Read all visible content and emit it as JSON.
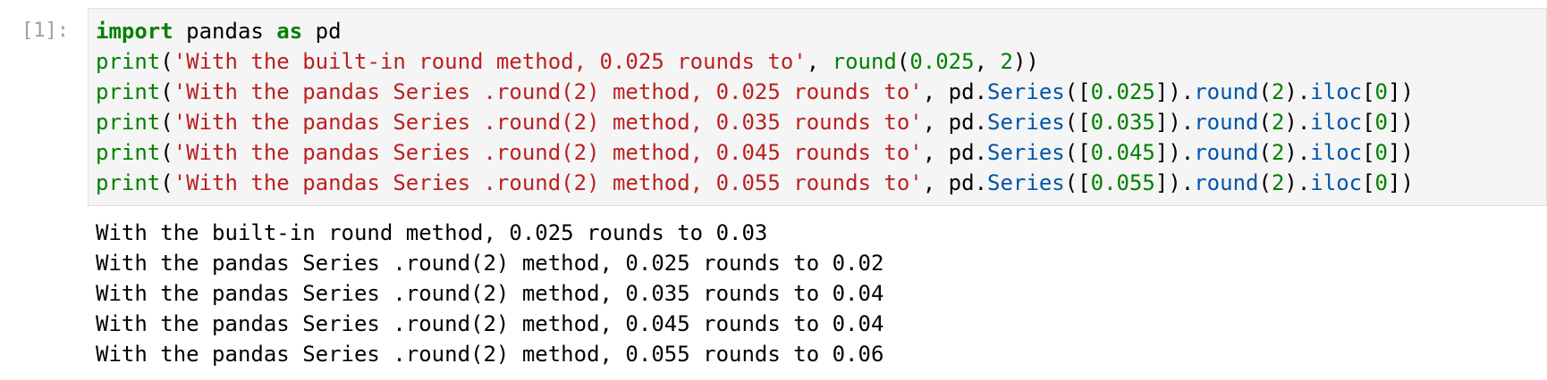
{
  "cell": {
    "prompt": "[1]:",
    "code_lines": [
      [
        {
          "t": "import",
          "c": "kw"
        },
        {
          "t": " pandas ",
          "c": ""
        },
        {
          "t": "as",
          "c": "kw"
        },
        {
          "t": " pd",
          "c": ""
        }
      ],
      [
        {
          "t": "print",
          "c": "bi"
        },
        {
          "t": "(",
          "c": ""
        },
        {
          "t": "'With the built-in round method, 0.025 rounds to'",
          "c": "str"
        },
        {
          "t": ", ",
          "c": ""
        },
        {
          "t": "round",
          "c": "bi"
        },
        {
          "t": "(",
          "c": ""
        },
        {
          "t": "0.025",
          "c": "num"
        },
        {
          "t": ", ",
          "c": ""
        },
        {
          "t": "2",
          "c": "num"
        },
        {
          "t": "))",
          "c": ""
        }
      ],
      [
        {
          "t": "print",
          "c": "bi"
        },
        {
          "t": "(",
          "c": ""
        },
        {
          "t": "'With the pandas Series .round(2) method, 0.025 rounds to'",
          "c": "str"
        },
        {
          "t": ", pd.",
          "c": ""
        },
        {
          "t": "Series",
          "c": "attr"
        },
        {
          "t": "([",
          "c": ""
        },
        {
          "t": "0.025",
          "c": "num"
        },
        {
          "t": "]).",
          "c": ""
        },
        {
          "t": "round",
          "c": "attr"
        },
        {
          "t": "(",
          "c": ""
        },
        {
          "t": "2",
          "c": "num"
        },
        {
          "t": ").",
          "c": ""
        },
        {
          "t": "iloc",
          "c": "attr"
        },
        {
          "t": "[",
          "c": ""
        },
        {
          "t": "0",
          "c": "num"
        },
        {
          "t": "])",
          "c": ""
        }
      ],
      [
        {
          "t": "print",
          "c": "bi"
        },
        {
          "t": "(",
          "c": ""
        },
        {
          "t": "'With the pandas Series .round(2) method, 0.035 rounds to'",
          "c": "str"
        },
        {
          "t": ", pd.",
          "c": ""
        },
        {
          "t": "Series",
          "c": "attr"
        },
        {
          "t": "([",
          "c": ""
        },
        {
          "t": "0.035",
          "c": "num"
        },
        {
          "t": "]).",
          "c": ""
        },
        {
          "t": "round",
          "c": "attr"
        },
        {
          "t": "(",
          "c": ""
        },
        {
          "t": "2",
          "c": "num"
        },
        {
          "t": ").",
          "c": ""
        },
        {
          "t": "iloc",
          "c": "attr"
        },
        {
          "t": "[",
          "c": ""
        },
        {
          "t": "0",
          "c": "num"
        },
        {
          "t": "])",
          "c": ""
        }
      ],
      [
        {
          "t": "print",
          "c": "bi"
        },
        {
          "t": "(",
          "c": ""
        },
        {
          "t": "'With the pandas Series .round(2) method, 0.045 rounds to'",
          "c": "str"
        },
        {
          "t": ", pd.",
          "c": ""
        },
        {
          "t": "Series",
          "c": "attr"
        },
        {
          "t": "([",
          "c": ""
        },
        {
          "t": "0.045",
          "c": "num"
        },
        {
          "t": "]).",
          "c": ""
        },
        {
          "t": "round",
          "c": "attr"
        },
        {
          "t": "(",
          "c": ""
        },
        {
          "t": "2",
          "c": "num"
        },
        {
          "t": ").",
          "c": ""
        },
        {
          "t": "iloc",
          "c": "attr"
        },
        {
          "t": "[",
          "c": ""
        },
        {
          "t": "0",
          "c": "num"
        },
        {
          "t": "])",
          "c": ""
        }
      ],
      [
        {
          "t": "print",
          "c": "bi"
        },
        {
          "t": "(",
          "c": ""
        },
        {
          "t": "'With the pandas Series .round(2) method, 0.055 rounds to'",
          "c": "str"
        },
        {
          "t": ", pd.",
          "c": ""
        },
        {
          "t": "Series",
          "c": "attr"
        },
        {
          "t": "([",
          "c": ""
        },
        {
          "t": "0.055",
          "c": "num"
        },
        {
          "t": "]).",
          "c": ""
        },
        {
          "t": "round",
          "c": "attr"
        },
        {
          "t": "(",
          "c": ""
        },
        {
          "t": "2",
          "c": "num"
        },
        {
          "t": ").",
          "c": ""
        },
        {
          "t": "iloc",
          "c": "attr"
        },
        {
          "t": "[",
          "c": ""
        },
        {
          "t": "0",
          "c": "num"
        },
        {
          "t": "])",
          "c": ""
        }
      ]
    ],
    "output_lines": [
      "With the built-in round method, 0.025 rounds to 0.03",
      "With the pandas Series .round(2) method, 0.025 rounds to 0.02",
      "With the pandas Series .round(2) method, 0.035 rounds to 0.04",
      "With the pandas Series .round(2) method, 0.045 rounds to 0.04",
      "With the pandas Series .round(2) method, 0.055 rounds to 0.06"
    ]
  },
  "colors": {
    "keyword": "#008000",
    "string": "#ba2121",
    "number": "#008000",
    "attribute": "#0055aa",
    "prompt": "#9e9e9e",
    "input_background": "#f5f5f5"
  }
}
